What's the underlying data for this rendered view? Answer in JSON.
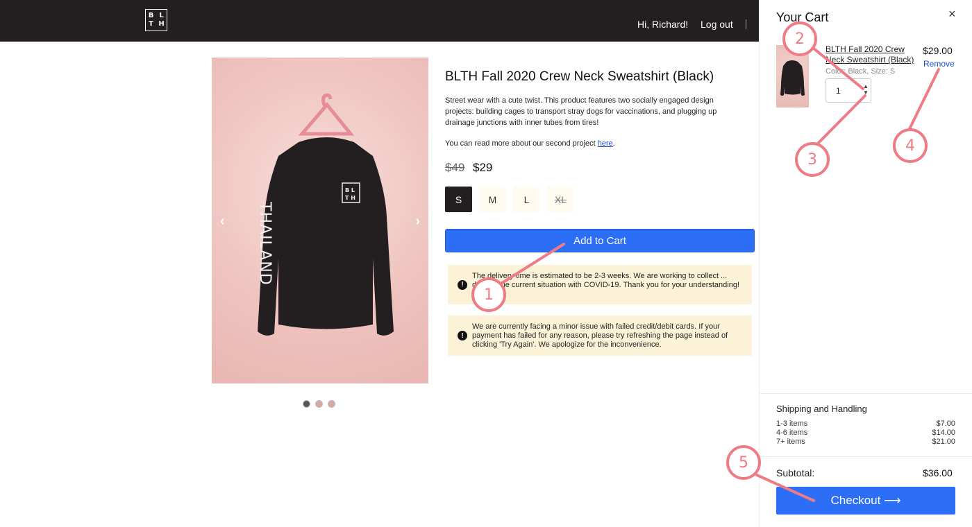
{
  "header": {
    "logo_letters": [
      "B",
      "L",
      "T",
      "H"
    ],
    "greeting": "Hi, Richard!",
    "logout_label": "Log out"
  },
  "product": {
    "title": "BLTH Fall 2020 Crew Neck Sweatshirt (Black)",
    "description": "Street wear with a cute twist. This product features two socially engaged design projects: building cages to transport stray dogs for vaccinations, and plugging up drainage junctions with inner tubes from tires!",
    "more_text": "You can read more about our second project ",
    "more_link": "here",
    "more_end": ".",
    "old_price": "$49",
    "price": "$29",
    "sizes": [
      "S",
      "M",
      "L",
      "XL"
    ],
    "selected_size": "S",
    "unavailable_size": "XL",
    "add_to_cart_label": "Add to Cart",
    "sleeve_text": "THAILAND",
    "carousel_prev": "‹",
    "carousel_next": "›",
    "carousel_current": 1,
    "carousel_count": 3
  },
  "notices": [
    "The delivery time is estimated to be 2-3 weeks. We are working to collect ... despite the current situation with COVID-19. Thank you for your understanding!",
    "We are currently facing a minor issue with failed credit/debit cards. If your payment has failed for any reason, please try refreshing the page instead of clicking 'Try Again'. We apologize for the inconvenience."
  ],
  "notice_icon": "!",
  "cart": {
    "title": "Your Cart",
    "close_icon": "×",
    "item": {
      "name": "BLTH Fall 2020 Crew Neck Sweatshirt (Black)",
      "meta": "Color: Black, Size: S",
      "quantity": "1",
      "price": "$29.00",
      "remove_label": "Remove"
    },
    "shipping": {
      "title": "Shipping and Handling",
      "rows": [
        {
          "label": "1-3 items",
          "price": "$7.00"
        },
        {
          "label": "4-6 items",
          "price": "$14.00"
        },
        {
          "label": "7+ items",
          "price": "$21.00"
        }
      ]
    },
    "subtotal_label": "Subtotal:",
    "subtotal": "$36.00",
    "checkout_label": "Checkout ⟶"
  },
  "annotations": [
    "1",
    "2",
    "3",
    "4",
    "5"
  ],
  "colors": {
    "accent": "#2d6ef6",
    "header_bg": "#231f20",
    "product_bg": "#efc4bf",
    "notice_bg": "#fcf2d8",
    "annotation": "#ef7b86"
  }
}
